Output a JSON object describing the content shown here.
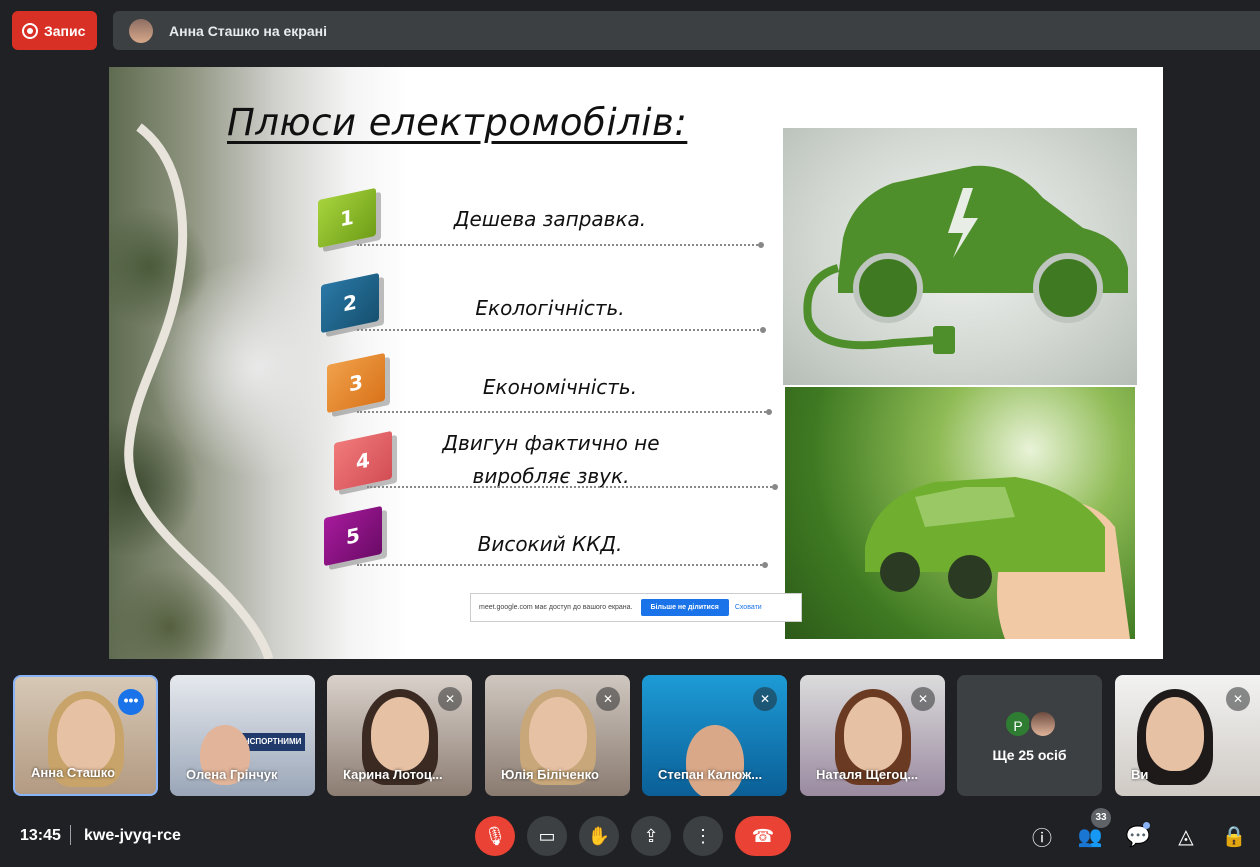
{
  "record": {
    "label": "Запис"
  },
  "presenter": {
    "label": "Анна Сташко на екрані"
  },
  "slide": {
    "title": "Плюси електромобілів:",
    "points": [
      {
        "num": "1",
        "text": "Дешева заправка."
      },
      {
        "num": "2",
        "text": "Екологічність."
      },
      {
        "num": "3",
        "text": "Економічність."
      },
      {
        "num": "4",
        "text": "Двигун фактично не виробляє звук."
      },
      {
        "num": "5",
        "text": "Високий ККД."
      }
    ]
  },
  "share_notice": {
    "text": "meet.google.com має доступ до вашого екрана.",
    "stop": "Більше не ділитися",
    "hide": "Сховати"
  },
  "participants": [
    {
      "name": "Анна Сташко"
    },
    {
      "name": "Олена Грінчук"
    },
    {
      "name": "Карина Лотоц..."
    },
    {
      "name": "Юлія Біліченко"
    },
    {
      "name": "Степан Калюж..."
    },
    {
      "name": "Наталя Щегоц..."
    },
    {
      "name": "Ще 25 осіб",
      "initial": "Р"
    },
    {
      "name": "Ви"
    }
  ],
  "footer": {
    "time": "13:45",
    "meeting_code": "kwe-jvyq-rce",
    "people_count": "33"
  },
  "colors": {
    "record": "#d93025",
    "end_call": "#ea4335",
    "accent": "#1a73e8"
  },
  "icons": [
    "record-icon",
    "mic-off-icon",
    "camera-icon",
    "raise-hand-icon",
    "present-icon",
    "more-icon",
    "end-call-icon",
    "info-icon",
    "people-icon",
    "chat-icon",
    "activities-icon",
    "host-controls-icon"
  ]
}
